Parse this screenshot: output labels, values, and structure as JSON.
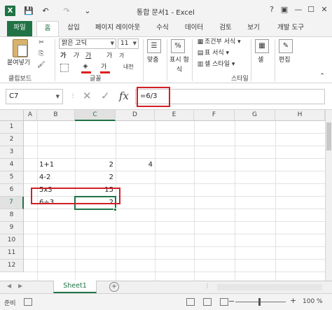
{
  "window": {
    "title": "통합 문서1 - Excel",
    "help": "?",
    "restore": "▣",
    "minimize": "—",
    "maximize": "☐",
    "close": "✕"
  },
  "quick_access": {
    "logo": "X",
    "save": "💾",
    "undo": "↶",
    "redo": "↷",
    "customize": "⌄"
  },
  "tabs": [
    "파일",
    "홈",
    "삽입",
    "페이지 레이아웃",
    "수식",
    "데이터",
    "검토",
    "보기",
    "개발 도구"
  ],
  "ribbon": {
    "clipboard": {
      "paste_label": "붙여넣기",
      "group_label": "클립보드"
    },
    "font": {
      "name": "맑은 고딕",
      "size": "11",
      "bold": "가",
      "italic": "가",
      "underline": "가",
      "grow": "가",
      "shrink": "가",
      "phonetic": "내천",
      "group_label": "글꼴"
    },
    "alignment": {
      "label": "맞춤"
    },
    "number": {
      "label": "표시 형식",
      "percent": "%"
    },
    "styles": {
      "conditional": "조건부 서식 ▾",
      "table": "표 서식 ▾",
      "cell_styles": "셀 스타일 ▾",
      "group_label": "스타일"
    },
    "cells": {
      "label": "셀"
    },
    "editing": {
      "label": "편집"
    }
  },
  "formula_bar": {
    "name_box": "C7",
    "cancel": "✕",
    "enter": "✓",
    "fx": "fx",
    "formula": "=6/3"
  },
  "grid": {
    "columns": [
      "A",
      "B",
      "C",
      "D",
      "E",
      "F",
      "G",
      "H"
    ],
    "rows": [
      "1",
      "2",
      "3",
      "4",
      "5",
      "6",
      "7",
      "8",
      "9",
      "10",
      "11",
      "12"
    ],
    "cells": {
      "B4": "1+1",
      "C4": "2",
      "D4": "4",
      "B5": "4-2",
      "C5": "2",
      "B6": "5x3",
      "C6": "15",
      "B7": "6÷3",
      "C7": "2"
    },
    "active_cell": "C7"
  },
  "sheets": [
    "Sheet1"
  ],
  "status": {
    "ready": "준비",
    "zoom": "100 %"
  },
  "colors": {
    "excel_green": "#217346",
    "highlight_red": "#d21f26"
  },
  "icons": [
    "excel-logo-icon",
    "save-icon",
    "undo-icon",
    "redo-icon",
    "paste-icon",
    "cut-icon",
    "copy-icon",
    "format-painter-icon",
    "bold-icon",
    "italic-icon",
    "underline-icon",
    "border-icon",
    "fill-color-icon",
    "font-color-icon",
    "align-icon",
    "percent-icon",
    "cells-icon",
    "editing-icon",
    "add-sheet-icon"
  ]
}
